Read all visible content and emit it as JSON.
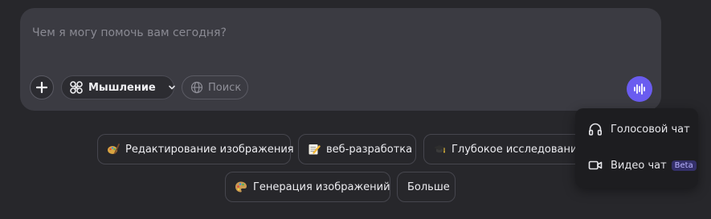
{
  "composer": {
    "placeholder": "Чем я могу помочь вам сегодня?",
    "thinking_label": "Мышление",
    "search_label": "Поиск"
  },
  "suggestions": [
    {
      "label": "Редактирование изображения",
      "icon": "palette-brush-icon"
    },
    {
      "label": "веб-разработка",
      "icon": "memo-pencil-icon"
    },
    {
      "label": "Глубокое исследование",
      "icon": "graduation-cap-icon"
    },
    {
      "label": "Генерация изображений",
      "icon": "palette-icon"
    },
    {
      "label": "Больше",
      "icon": ""
    }
  ],
  "voice_menu": {
    "items": [
      {
        "label": "Голосовой чат",
        "icon": "headphones-icon",
        "badge": ""
      },
      {
        "label": "Видео чат",
        "icon": "video-camera-icon",
        "badge": "Beta"
      }
    ]
  },
  "colors": {
    "background": "#27272b",
    "composer": "#3b3b42",
    "accent": "#6a5cf0",
    "menu": "#1d1d20"
  }
}
